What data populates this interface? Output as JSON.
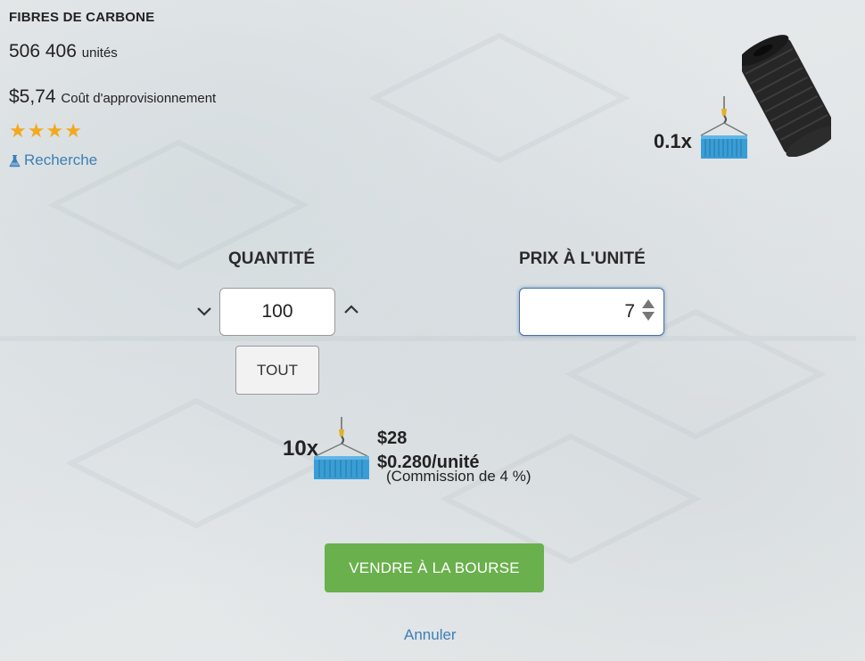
{
  "product": {
    "title": "FIBRES DE CARBONE",
    "quantity": "506 406",
    "quantity_unit": "unités",
    "cost": "$5,74",
    "cost_label": "Coût d'approvisionnement",
    "rating": 4,
    "research_label": "Recherche",
    "research_icon": "flask-icon",
    "multiplier": "0.1x"
  },
  "form": {
    "quantity_label": "QUANTITÉ",
    "quantity_value": "100",
    "all_button": "TOUT",
    "price_label": "PRIX À L'UNITÉ",
    "price_value": "7"
  },
  "summary": {
    "multiplier": "10x",
    "total": "$28",
    "per_unit": "$0.280/unité",
    "commission": "(Commission de 4 %)"
  },
  "actions": {
    "sell_label": "VENDRE À LA BOURSE",
    "cancel_label": "Annuler"
  },
  "colors": {
    "accent_green": "#6ab04c",
    "link_blue": "#3c7fb6",
    "star": "#f2a91e"
  }
}
